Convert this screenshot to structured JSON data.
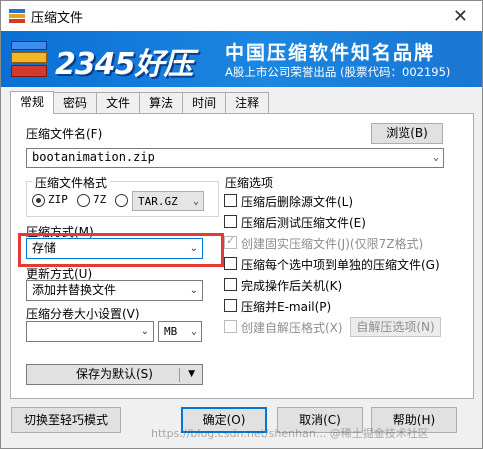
{
  "window": {
    "title": "压缩文件",
    "close_glyph": "✕"
  },
  "banner": {
    "brand": "2345好压",
    "slogan": "中国压缩软件知名品牌",
    "subtitle": "A股上市公司荣誉出品 (股票代码：002195)"
  },
  "tabs": [
    {
      "label": "常规",
      "active": true
    },
    {
      "label": "密码",
      "active": false
    },
    {
      "label": "文件",
      "active": false
    },
    {
      "label": "算法",
      "active": false
    },
    {
      "label": "时间",
      "active": false
    },
    {
      "label": "注释",
      "active": false
    }
  ],
  "general": {
    "filename_label": "压缩文件名(F)",
    "browse_label": "浏览(B)",
    "filename_value": "bootanimation.zip",
    "format_label": "压缩文件格式",
    "formats": [
      {
        "label": "ZIP",
        "selected": true
      },
      {
        "label": "7Z",
        "selected": false
      }
    ],
    "format_combo_value": "TAR.GZ",
    "method_label": "压缩方式(M)",
    "method_value": "存储",
    "update_label": "更新方式(U)",
    "update_value": "添加并替换文件",
    "split_label": "压缩分卷大小设置(V)",
    "split_value": "",
    "split_unit": "MB",
    "save_default_label": "保存为默认(S)",
    "options_label": "压缩选项",
    "options": [
      {
        "label": "压缩后删除源文件(L)",
        "checked": false,
        "disabled": false
      },
      {
        "label": "压缩后测试压缩文件(E)",
        "checked": false,
        "disabled": false
      },
      {
        "label": "创建固实压缩文件(J)(仅限7Z格式)",
        "checked": true,
        "disabled": true
      },
      {
        "label": "压缩每个选中项到单独的压缩文件(G)",
        "checked": false,
        "disabled": false
      },
      {
        "label": "完成操作后关机(K)",
        "checked": false,
        "disabled": false
      },
      {
        "label": "压缩并E-mail(P)",
        "checked": false,
        "disabled": false
      },
      {
        "label": "创建自解压格式(X)",
        "checked": false,
        "disabled": true
      }
    ],
    "sfx_button_label": "自解压选项(N)"
  },
  "footer": {
    "light_mode_label": "切换至轻巧模式",
    "ok_label": "确定(O)",
    "cancel_label": "取消(C)",
    "help_label": "帮助(H)"
  },
  "watermark": "https://blog.csdn.net/shenhan... @稀土掘金技术社区",
  "colors": {
    "banner": "#1a80dc",
    "highlight": "#e53935",
    "primary_border": "#0078d7"
  }
}
